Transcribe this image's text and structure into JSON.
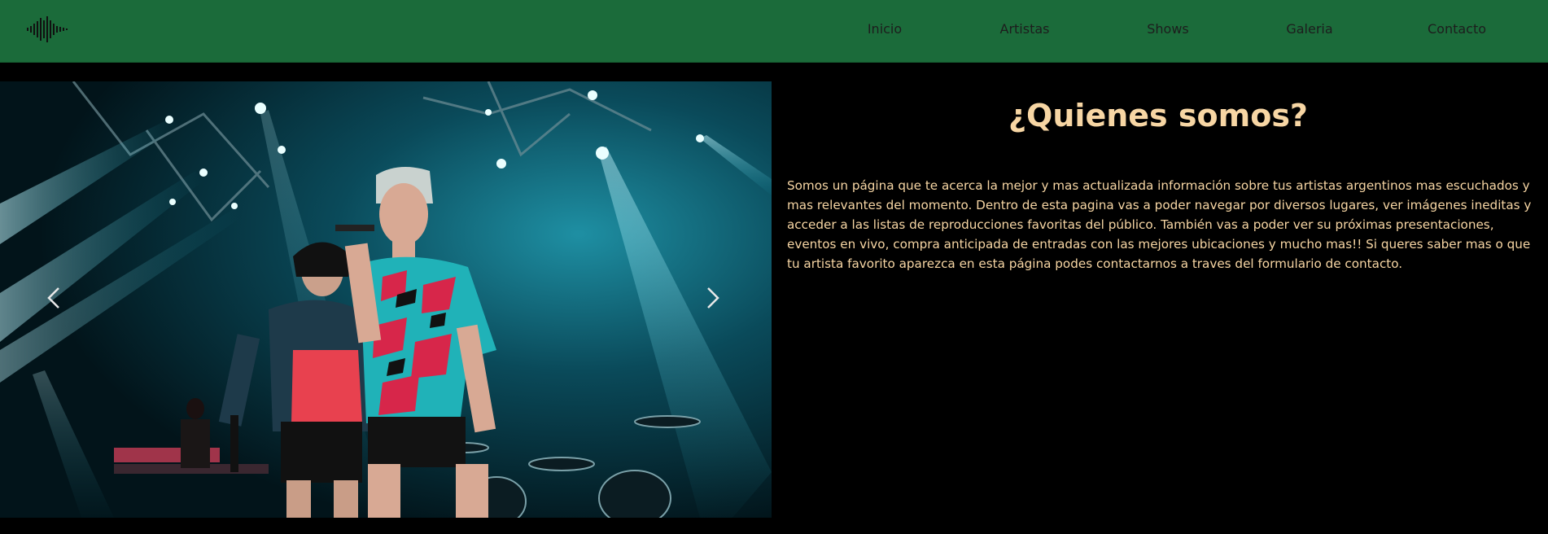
{
  "nav": {
    "logo_icon": "soundwave-icon",
    "links": [
      {
        "label": "Inicio"
      },
      {
        "label": "Artistas"
      },
      {
        "label": "Shows"
      },
      {
        "label": "Galeria"
      },
      {
        "label": "Contacto"
      }
    ]
  },
  "carousel": {
    "image_description": "photo-concert-two-performers",
    "prev_icon": "chevron-left-icon",
    "next_icon": "chevron-right-icon"
  },
  "about": {
    "title": "¿Quienes somos?",
    "body": "Somos un página que te acerca la mejor y mas actualizada información sobre tus artistas argentinos mas escuchados y mas relevantes del momento. Dentro de esta pagina vas a poder navegar por diversos lugares, ver imágenes ineditas y acceder a las listas de reproducciones favoritas del público. También vas a poder ver su próximas presentaciones, eventos en vivo, compra anticipada de entradas con las mejores ubicaciones y mucho mas!! Si queres saber mas o que tu artista favorito aparezca en esta página podes contactarnos a traves del formulario de contacto."
  },
  "colors": {
    "navbar_bg": "#1b6b3a",
    "page_bg": "#000000",
    "accent_text": "#f7d6a4",
    "nav_text": "#1d1d1d"
  }
}
